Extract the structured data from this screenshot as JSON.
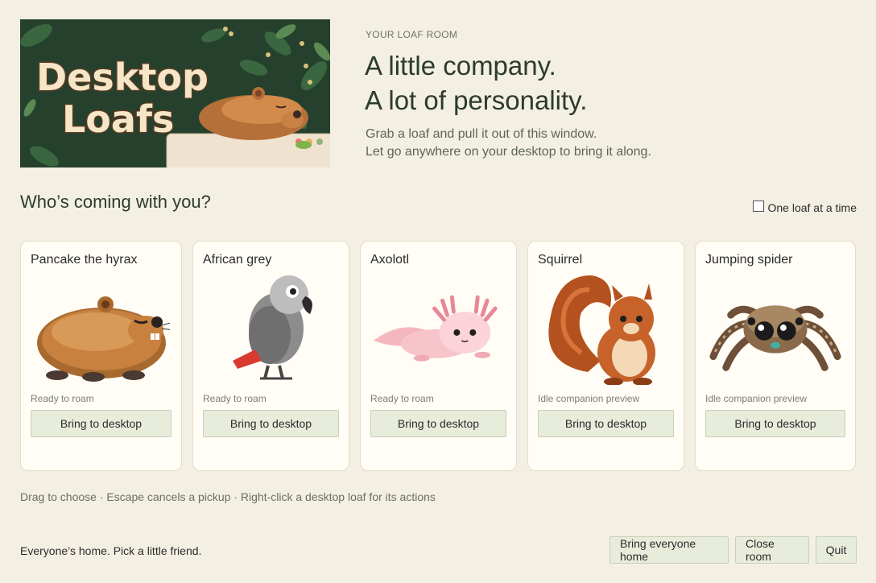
{
  "hero": {
    "logo_line1": "Desktop",
    "logo_line2": "Loafs",
    "eyebrow": "YOUR LOAF ROOM",
    "title_line1": "A little company.",
    "title_line2": "A lot of personality.",
    "sub_line1": "Grab a loaf and pull it out of this window.",
    "sub_line2": "Let go anywhere on your desktop to bring it along."
  },
  "section": {
    "title": "Who’s coming with you?",
    "toggle_label": "One loaf at a time",
    "toggle_checked": false
  },
  "loafs": [
    {
      "name": "Pancake the hyrax",
      "status": "Ready to roam",
      "button": "Bring to desktop",
      "icon": "hyrax-icon"
    },
    {
      "name": "African grey",
      "status": "Ready to roam",
      "button": "Bring to desktop",
      "icon": "parrot-icon"
    },
    {
      "name": "Axolotl",
      "status": "Ready to roam",
      "button": "Bring to desktop",
      "icon": "axolotl-icon"
    },
    {
      "name": "Squirrel",
      "status": "Idle companion preview",
      "button": "Bring to desktop",
      "icon": "squirrel-icon"
    },
    {
      "name": "Jumping spider",
      "status": "Idle companion preview",
      "button": "Bring to desktop",
      "icon": "spider-icon"
    }
  ],
  "hint": "Drag to choose · Escape cancels a pickup · Right-click a desktop loaf for its actions",
  "footer": {
    "status": "Everyone’s home. Pick a little friend.",
    "bring_home": "Bring everyone home",
    "close_room": "Close room",
    "quit": "Quit"
  },
  "colors": {
    "background": "#f4efe3",
    "card": "#fffdf6",
    "button": "#e8ecdb",
    "banner_green": "#24402c"
  }
}
